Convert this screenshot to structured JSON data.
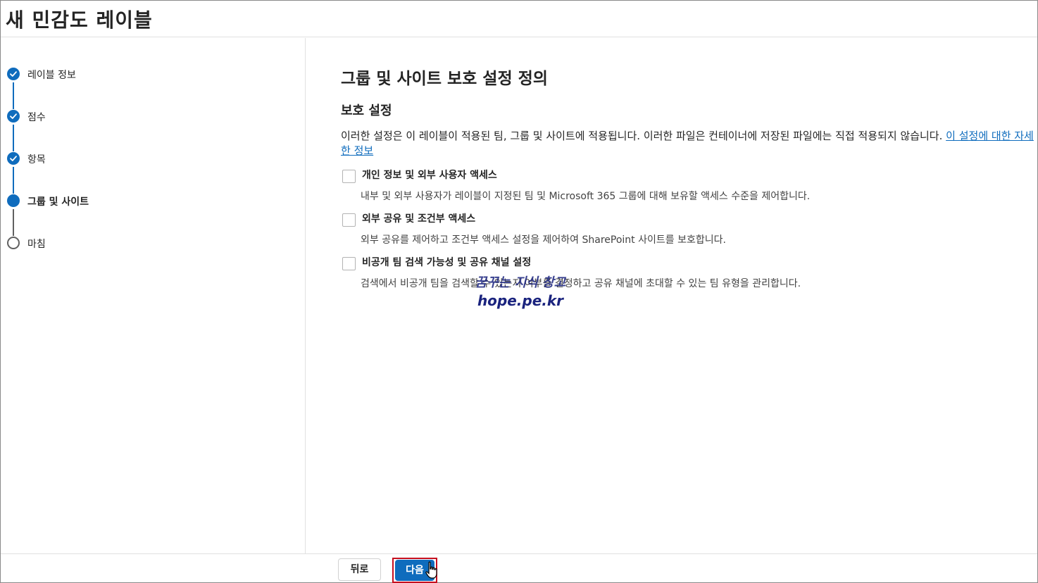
{
  "header": {
    "title": "새 민감도 레이블"
  },
  "steps": [
    {
      "label": "레이블 정보",
      "state": "completed",
      "icon": "checkmark-icon"
    },
    {
      "label": "점수",
      "state": "completed",
      "icon": "checkmark-icon"
    },
    {
      "label": "항목",
      "state": "completed",
      "icon": "checkmark-icon"
    },
    {
      "label": "그룹 및 사이트",
      "state": "current",
      "icon": "filled-circle-icon"
    },
    {
      "label": "마침",
      "state": "pending",
      "icon": "empty-circle-icon"
    }
  ],
  "main": {
    "title": "그룹 및 사이트 보호 설정 정의",
    "subtitle": "보호 설정",
    "description": "이러한 설정은 이 레이블이 적용된 팀, 그룹 및 사이트에 적용됩니다. 이러한 파일은 컨테이너에 저장된 파일에는 직접 적용되지 않습니다.",
    "link": "이 설정에 대한 자세한 정보",
    "options": [
      {
        "title": "개인 정보 및 외부 사용자 액세스",
        "description": "내부 및 외부 사용자가 레이블이 지정된 팀 및 Microsoft 365 그룹에 대해 보유할 액세스 수준을 제어합니다.",
        "checked": false
      },
      {
        "title": "외부 공유 및 조건부 액세스",
        "description": "외부 공유를 제어하고 조건부 액세스 설정을 제어하여 SharePoint 사이트를 보호합니다.",
        "checked": false
      },
      {
        "title": "비공개 팀 검색 가능성 및 공유 채널 설정",
        "description": "검색에서 비공개 팀을 검색할 수 있는지 여부를 결정하고 공유 채널에 초대할 수 있는 팀 유형을 관리합니다.",
        "checked": false
      }
    ]
  },
  "watermark": {
    "line1": "꿈꾸는 지식 창고",
    "line2": "hope.pe.kr"
  },
  "footer": {
    "back_label": "뒤로",
    "next_label": "다음"
  },
  "colors": {
    "accent": "#0f6cbd",
    "highlight_border": "#c50f1f",
    "watermark": "#1a237e"
  }
}
